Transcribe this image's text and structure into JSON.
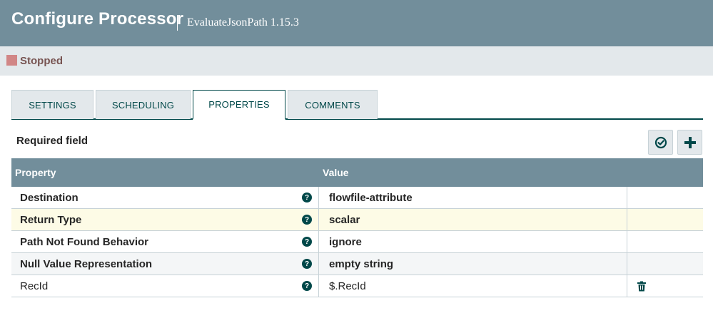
{
  "header": {
    "title": "Configure Processor",
    "subtitle": "EvaluateJsonPath 1.15.3"
  },
  "status": {
    "label": "Stopped",
    "color": "#d18686"
  },
  "tabs": [
    {
      "label": "SETTINGS",
      "active": false
    },
    {
      "label": "SCHEDULING",
      "active": false
    },
    {
      "label": "PROPERTIES",
      "active": true
    },
    {
      "label": "COMMENTS",
      "active": false
    }
  ],
  "required_label": "Required field",
  "toolbar": {
    "verify_icon": "check-circle-icon",
    "add_icon": "plus-icon"
  },
  "table": {
    "headers": {
      "property": "Property",
      "value": "Value"
    },
    "rows": [
      {
        "property": "Destination",
        "value": "flowfile-attribute",
        "required": true
      },
      {
        "property": "Return Type",
        "value": "scalar",
        "required": true
      },
      {
        "property": "Path Not Found Behavior",
        "value": "ignore",
        "required": true
      },
      {
        "property": "Null Value Representation",
        "value": "empty string",
        "required": true
      },
      {
        "property": "RecId",
        "value": "$.RecId",
        "required": false
      }
    ]
  },
  "colors": {
    "header_bg": "#728e9b",
    "accent": "#004849",
    "status_bg": "#e3e8eb"
  }
}
